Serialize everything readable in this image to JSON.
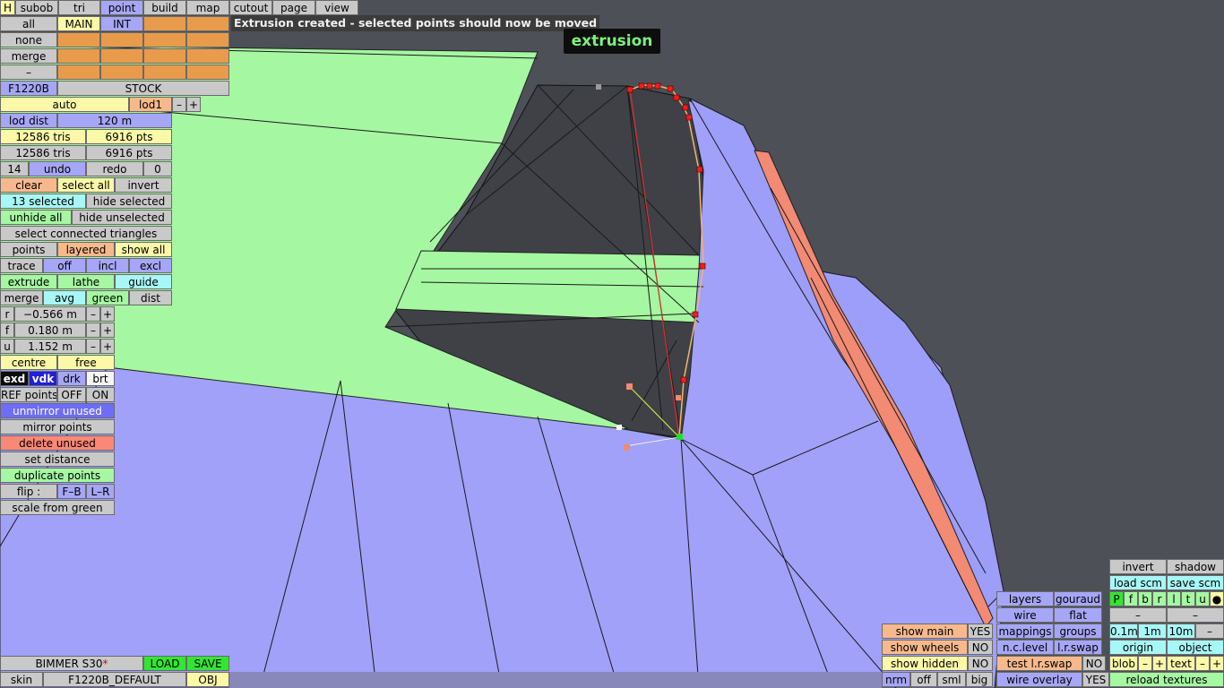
{
  "status_message": "Extrusion created - selected points should now be moved",
  "mode_badge": "extrusion",
  "top_tabs": [
    "H",
    "subob",
    "tri",
    "point",
    "build",
    "map",
    "cutout",
    "page",
    "view"
  ],
  "left_panel": {
    "all": "all",
    "main": "MAIN",
    "int": "INT",
    "none": "none",
    "merge_top": "merge",
    "dash": "–",
    "car_code": "F1220B",
    "stock": "STOCK",
    "auto": "auto",
    "lod1": "lod1",
    "minus": "–",
    "plus": "+",
    "lod_dist_label": "lod dist",
    "lod_dist_value": "120 m",
    "tris_1": "12586 tris",
    "pts_1": "6916 pts",
    "tris_2": "12586 tris",
    "pts_2": "6916 pts",
    "undo_count": "14",
    "undo": "undo",
    "redo": "redo",
    "redo_count": "0",
    "clear": "clear",
    "select_all": "select all",
    "invert": "invert",
    "selected": "13 selected",
    "hide_selected": "hide selected",
    "unhide_all": "unhide all",
    "hide_unselected": "hide unselected",
    "select_connected": "select connected triangles",
    "points": "points",
    "layered": "layered",
    "show_all": "show all",
    "trace": "trace",
    "off": "off",
    "incl": "incl",
    "excl": "excl",
    "extrude": "extrude",
    "lathe": "lathe",
    "guide": "guide",
    "merge": "merge",
    "avg": "avg",
    "green": "green",
    "dist": "dist",
    "coords": [
      {
        "axis": "r",
        "value": "−0.566 m"
      },
      {
        "axis": "f",
        "value": "0.180 m"
      },
      {
        "axis": "u",
        "value": "1.152 m"
      }
    ],
    "centre": "centre",
    "free": "free",
    "exd": "exd",
    "vdk": "vdk",
    "drk": "drk",
    "brt": "brt",
    "ref_points": "REF points",
    "ref_off": "OFF",
    "ref_on": "ON",
    "unmirror_unused": "unmirror unused",
    "mirror_points": "mirror points",
    "delete_unused": "delete unused",
    "set_distance": "set distance",
    "duplicate_points": "duplicate points",
    "flip": "flip :",
    "flip_fb": "F–B",
    "flip_lr": "L–R",
    "scale_from_green": "scale from green"
  },
  "bottom_left": {
    "car_name": "BIMMER S30",
    "modified_mark": "*",
    "load": "LOAD",
    "save": "SAVE",
    "skin": "skin",
    "skin_name": "F1220B_DEFAULT",
    "obj": "OBJ"
  },
  "bottom_right": {
    "invert": "invert",
    "shadow": "shadow",
    "load_scm": "load scm",
    "save_scm": "save scm",
    "view_letters": [
      "P",
      "f",
      "b",
      "r",
      "l",
      "t",
      "u",
      "●"
    ],
    "layers": "layers",
    "gouraud": "gouraud",
    "wire": "wire",
    "flat": "flat",
    "mappings": "mappings",
    "groups": "groups",
    "nc_level": "n.c.level",
    "lr_swap": "l.r.swap",
    "test_lr_swap": "test l.r.swap",
    "test_no": "NO",
    "wire_overlay": "wire overlay",
    "wire_yes": "YES",
    "show_main": "show main",
    "show_main_v": "YES",
    "show_wheels": "show wheels",
    "show_wheels_v": "NO",
    "show_hidden": "show hidden",
    "show_hidden_v": "NO",
    "nrm": "nrm",
    "off": "off",
    "sml": "sml",
    "big": "big",
    "scale_01": "0.1m",
    "scale_1": "1m",
    "scale_10": "10m",
    "dash": "–",
    "origin": "origin",
    "object": "object",
    "blob": "blob",
    "blob_minus": "–",
    "blob_plus": "+",
    "text": "text",
    "text_minus": "–",
    "text_plus": "+",
    "reload_textures": "reload textures"
  },
  "colors": {
    "background": "#4d5057",
    "mesh_purple": "#a1a1fa",
    "mesh_green": "#a5f7a1",
    "mesh_dark": "#3f4147",
    "selected_point": "#ff1a1a",
    "salmon_strip": "#f28a74"
  }
}
